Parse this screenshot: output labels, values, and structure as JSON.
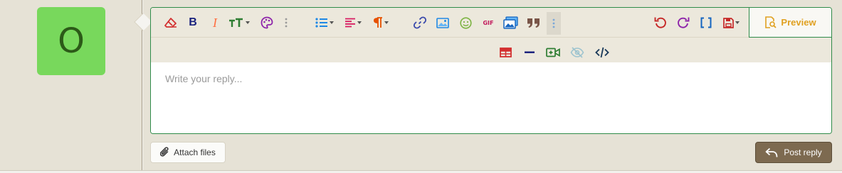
{
  "avatar": {
    "letter": "O",
    "bg_color": "#78d85c",
    "letter_color": "#2c5a18"
  },
  "editor": {
    "accent_color": "#2f8b49",
    "toolbar_row1": [
      {
        "name": "remove-format-icon",
        "color": "#d32f2f",
        "dropdown": false
      },
      {
        "name": "bold-icon",
        "label": "B",
        "color": "#1a237e",
        "dropdown": false
      },
      {
        "name": "italic-icon",
        "label": "I",
        "color": "#ff7043",
        "dropdown": false
      },
      {
        "name": "font-size-icon",
        "label": "TT",
        "color": "#2e7d32",
        "dropdown": true
      },
      {
        "name": "text-color-icon",
        "color": "#8e24aa",
        "dropdown": false
      },
      {
        "name": "more-text-icon",
        "color": "#999999",
        "dropdown": false
      },
      {
        "name": "list-icon",
        "color": "#1e88e5",
        "dropdown": true
      },
      {
        "name": "align-icon",
        "color": "#d81b60",
        "dropdown": true
      },
      {
        "name": "paragraph-icon",
        "color": "#e65100",
        "dropdown": true
      },
      {
        "name": "link-icon",
        "color": "#3949ab",
        "dropdown": false
      },
      {
        "name": "image-icon",
        "color": "#1e88e5",
        "dropdown": false
      },
      {
        "name": "emoji-icon",
        "color": "#7cb342",
        "dropdown": false
      },
      {
        "name": "gif-icon",
        "label": "GIF",
        "color": "#c2185b",
        "dropdown": false
      },
      {
        "name": "media-icon",
        "color": "#1565c0",
        "dropdown": false
      },
      {
        "name": "quote-icon",
        "color": "#795548",
        "dropdown": false
      },
      {
        "name": "more-insert-icon",
        "color": "#7aa7d8",
        "dropdown": false
      },
      {
        "name": "undo-icon",
        "color": "#c62828",
        "dropdown": false
      },
      {
        "name": "redo-icon",
        "color": "#8e24aa",
        "dropdown": false
      },
      {
        "name": "bbcode-toggle-icon",
        "label": "[ ]",
        "color": "#1565c0",
        "dropdown": false
      },
      {
        "name": "drafts-icon",
        "color": "#c62828",
        "dropdown": true
      }
    ],
    "toolbar_row2": [
      {
        "name": "table-icon",
        "color": "#d32f2f"
      },
      {
        "name": "horizontal-rule-icon",
        "color": "#1a237e"
      },
      {
        "name": "insert-video-icon",
        "color": "#2e7d32"
      },
      {
        "name": "spoiler-icon",
        "color": "#9ec4cf"
      },
      {
        "name": "code-icon",
        "color": "#1a3a5a"
      }
    ],
    "preview_label": "Preview",
    "placeholder": "Write your reply..."
  },
  "actions": {
    "attach_label": "Attach files",
    "post_label": "Post reply"
  }
}
